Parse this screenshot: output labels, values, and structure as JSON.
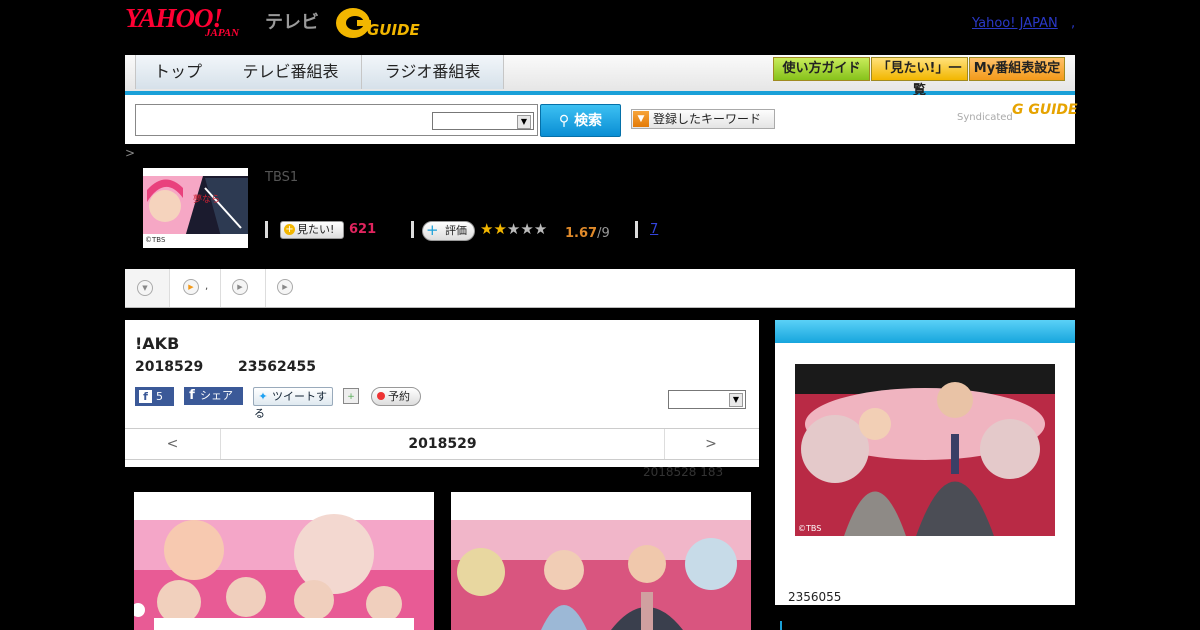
{
  "header": {
    "yahoo_logo": "YAHOO!",
    "japan_logo": "JAPAN",
    "tv_label": "テレビ",
    "gguide_logo": "G GUIDE",
    "yj_link": "Yahoo! JAPAN",
    "yj_link_suffix": ","
  },
  "nav": {
    "tabs": [
      "トップ",
      "テレビ番組表",
      "ラジオ番組表"
    ],
    "guide_buttons": [
      "使い方ガイド",
      "「見たい!」一覧",
      "My番組表設定"
    ]
  },
  "search": {
    "placeholder": "",
    "select_value": "",
    "button_label": "検索",
    "keyword_button": "登録したキーワード",
    "syndicated_label": "Syndicated",
    "syndicated_logo": "G GUIDE"
  },
  "program": {
    "crumb": ">",
    "thumb_caption": "©TBS",
    "channel": "TBS1",
    "want_label": "見たい!",
    "want_count": "621",
    "rate_label": "評価",
    "rating": "1.67",
    "rating_total": "/9",
    "link_count": "7"
  },
  "subtabs": {
    "second_label": ","
  },
  "episode": {
    "title": "!AKB",
    "date": "2018529",
    "time": "23562455",
    "fb_count": "5",
    "fb_share": "シェア",
    "tweet": "ツイートする",
    "reserve": "予約",
    "prev": "<",
    "current_date": "2018529",
    "next": ">",
    "note": "2018528  183"
  },
  "right_panel": {
    "photo_caption": "©TBS",
    "count": "2356055"
  },
  "colors": {
    "accent_blue": "#1aa0d8",
    "yahoo_red": "#ff0033",
    "guide_orange": "#e6a300",
    "want_pink": "#e0245e",
    "rating_orange": "#e08a2a"
  }
}
